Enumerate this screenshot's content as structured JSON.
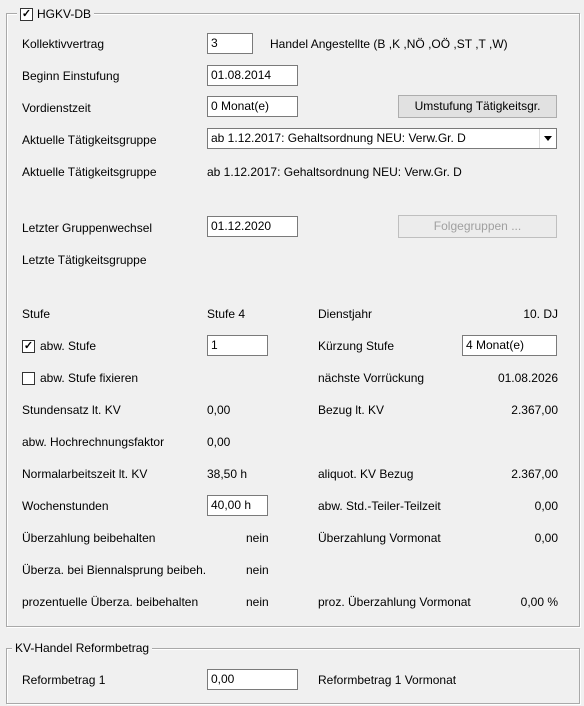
{
  "hgkv": {
    "title": "HGKV-DB",
    "checked": true,
    "kollektivvertrag_label": "Kollektivvertrag",
    "kollektivvertrag_value": "3",
    "kollektivvertrag_name": "Handel Angestellte (B ,K ,NÖ ,OÖ ,ST ,T ,W)",
    "beginn_label": "Beginn Einstufung",
    "beginn_value": "01.08.2014",
    "vordienstzeit_label": "Vordienstzeit",
    "vordienstzeit_value": "0  Monat(e)",
    "umstufung_button": "Umstufung Tätigkeitsgr.",
    "aktuelle_tg_label": "Aktuelle Tätigkeitsgruppe",
    "aktuelle_tg_select": "ab 1.12.2017: Gehaltsordnung NEU: Verw.Gr. D",
    "aktuelle_tg_label2": "Aktuelle Tätigkeitsgruppe",
    "aktuelle_tg_text": "ab 1.12.2017: Gehaltsordnung NEU: Verw.Gr. D",
    "letzter_wechsel_label": "Letzter Gruppenwechsel",
    "letzter_wechsel_value": "01.12.2020",
    "folgegruppen_button": "Folgegruppen ...",
    "letzte_tg_label": "Letzte Tätigkeitsgruppe",
    "stufe_label": "Stufe",
    "stufe_value": "Stufe 4",
    "dienstjahr_label": "Dienstjahr",
    "dienstjahr_value": "10. DJ",
    "abw_stufe_label": "abw. Stufe",
    "abw_stufe_checked": true,
    "abw_stufe_value": "1",
    "kuerzung_label": "Kürzung Stufe",
    "kuerzung_value": "4  Monat(e)",
    "abw_stufe_fix_label": "abw. Stufe fixieren",
    "abw_stufe_fix_checked": false,
    "naechste_label": "nächste Vorrückung",
    "naechste_value": "01.08.2026",
    "stundensatz_label": "Stundensatz lt. KV",
    "stundensatz_value": "0,00",
    "bezug_label": "Bezug lt. KV",
    "bezug_value": "2.367,00",
    "hochrechnung_label": "abw. Hochrechnungsfaktor",
    "hochrechnung_value": "0,00",
    "normalarbeitszeit_label": "Normalarbeitszeit lt. KV",
    "normalarbeitszeit_value": "38,50 h",
    "aliquot_label": "aliquot. KV Bezug",
    "aliquot_value": "2.367,00",
    "wochenstunden_label": "Wochenstunden",
    "wochenstunden_value": "40,00  h",
    "teiler_label": "abw. Std.-Teiler-Teilzeit",
    "teiler_value": "0,00",
    "ueberzahlung_label": "Überzahlung beibehalten",
    "ueberzahlung_value": "nein",
    "ueberzahlung_vm_label": "Überzahlung Vormonat",
    "ueberzahlung_vm_value": "0,00",
    "biennal_label": "Überza. bei Biennalsprung beibeh.",
    "biennal_value": "nein",
    "prozent_label": "prozentuelle Überza. beibehalten",
    "prozent_value": "nein",
    "proz_vm_label": "proz. Überzahlung Vormonat",
    "proz_vm_value": "0,00 %"
  },
  "reform": {
    "title": "KV-Handel Reformbetrag",
    "reformbetrag_label": "Reformbetrag 1",
    "reformbetrag_value": "0,00",
    "reformbetrag_vm_label": "Reformbetrag 1 Vormonat"
  },
  "checkmark": "✓"
}
